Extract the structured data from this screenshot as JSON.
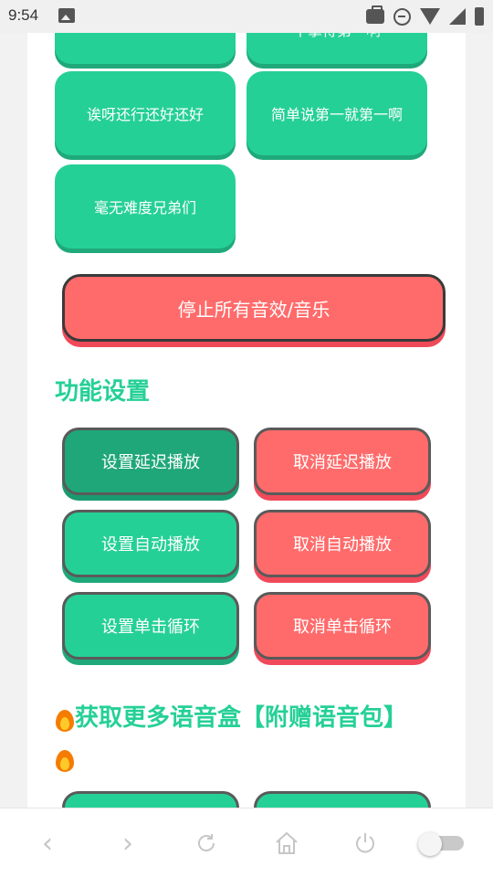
{
  "status_bar": {
    "time": "9:54"
  },
  "sound_buttons": [
    {
      "label": "不掌得第一啊"
    },
    {
      "label": ""
    },
    {
      "label": "诶呀还行还好还好"
    },
    {
      "label": "简单说第一就第一啊"
    },
    {
      "label": "毫无难度兄弟们"
    }
  ],
  "stop_button": {
    "label": "停止所有音效/音乐"
  },
  "function_section": {
    "title": "功能设置",
    "buttons": [
      {
        "label": "设置延迟播放"
      },
      {
        "label": "取消延迟播放"
      },
      {
        "label": "设置自动播放"
      },
      {
        "label": "取消自动播放"
      },
      {
        "label": "设置单击循环"
      },
      {
        "label": "取消单击循环"
      }
    ]
  },
  "more_section": {
    "title": "获取更多语音盒【附赠语音包】"
  },
  "bottom_nav": {
    "back": "‹",
    "forward": "›"
  },
  "colors": {
    "accent_green": "#25d096",
    "accent_red": "#ff6b6b"
  }
}
